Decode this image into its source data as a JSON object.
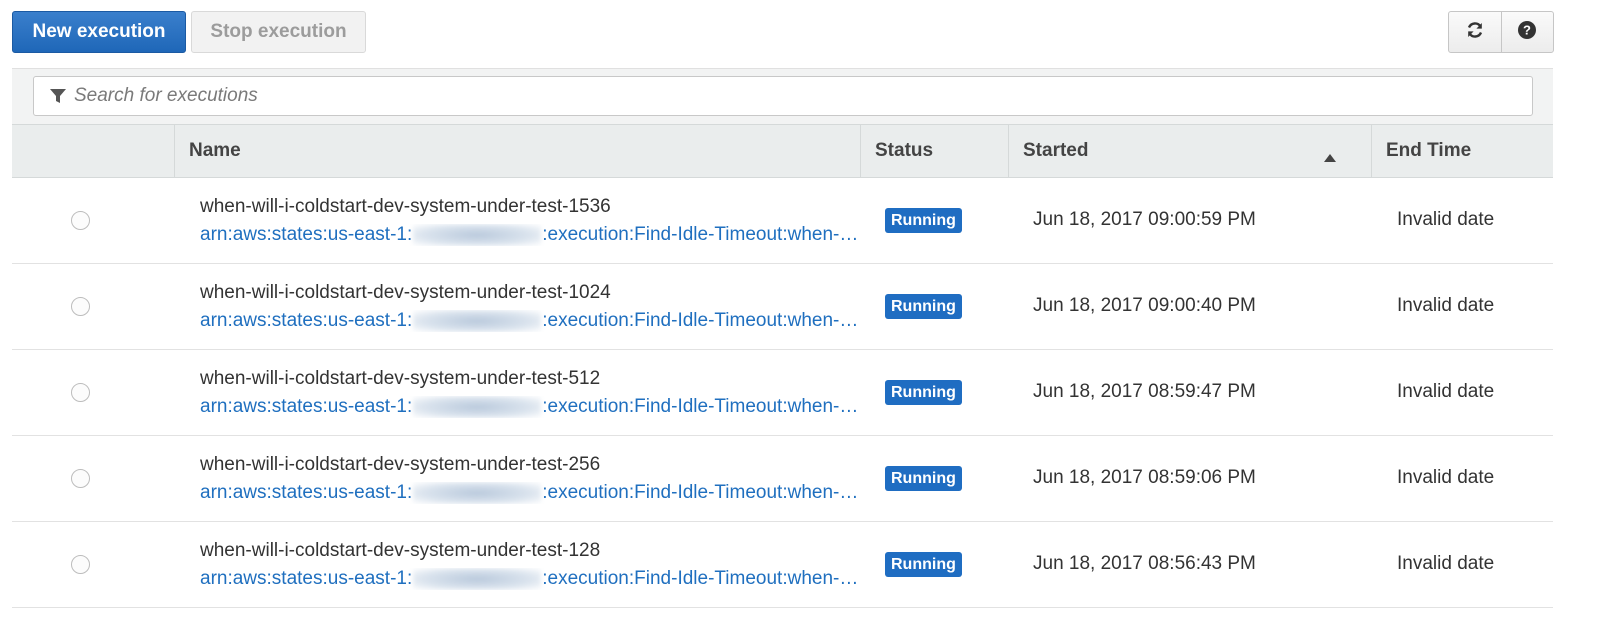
{
  "toolbar": {
    "new_execution_label": "New execution",
    "stop_execution_label": "Stop execution",
    "refresh_icon": "refresh-icon",
    "help_icon": "help-icon"
  },
  "search": {
    "placeholder": "Search for executions",
    "icon": "filter-icon"
  },
  "table": {
    "columns": [
      "Name",
      "Status",
      "Started",
      "End Time"
    ],
    "sort": {
      "column": "Started",
      "direction": "ascending-indicator"
    },
    "rows": [
      {
        "name": "when-will-i-coldstart-dev-system-under-test-1536",
        "arn_prefix": "arn:aws:states:us-east-1:",
        "arn_suffix": ":execution:Find-Idle-Timeout:when-…",
        "status": "Running",
        "started": "Jun 18, 2017 09:00:59 PM",
        "end_time": "Invalid date"
      },
      {
        "name": "when-will-i-coldstart-dev-system-under-test-1024",
        "arn_prefix": "arn:aws:states:us-east-1:",
        "arn_suffix": ":execution:Find-Idle-Timeout:when-…",
        "status": "Running",
        "started": "Jun 18, 2017 09:00:40 PM",
        "end_time": "Invalid date"
      },
      {
        "name": "when-will-i-coldstart-dev-system-under-test-512",
        "arn_prefix": "arn:aws:states:us-east-1:",
        "arn_suffix": ":execution:Find-Idle-Timeout:when-…",
        "status": "Running",
        "started": "Jun 18, 2017 08:59:47 PM",
        "end_time": "Invalid date"
      },
      {
        "name": "when-will-i-coldstart-dev-system-under-test-256",
        "arn_prefix": "arn:aws:states:us-east-1:",
        "arn_suffix": ":execution:Find-Idle-Timeout:when-…",
        "status": "Running",
        "started": "Jun 18, 2017 08:59:06 PM",
        "end_time": "Invalid date"
      },
      {
        "name": "when-will-i-coldstart-dev-system-under-test-128",
        "arn_prefix": "arn:aws:states:us-east-1:",
        "arn_suffix": ":execution:Find-Idle-Timeout:when-…",
        "status": "Running",
        "started": "Jun 18, 2017 08:56:43 PM",
        "end_time": "Invalid date"
      }
    ]
  },
  "colors": {
    "primary": "#1f67b8",
    "link": "#1f6fbf",
    "badge_running": "#1f6dc2",
    "header_bg": "#eaeded"
  }
}
